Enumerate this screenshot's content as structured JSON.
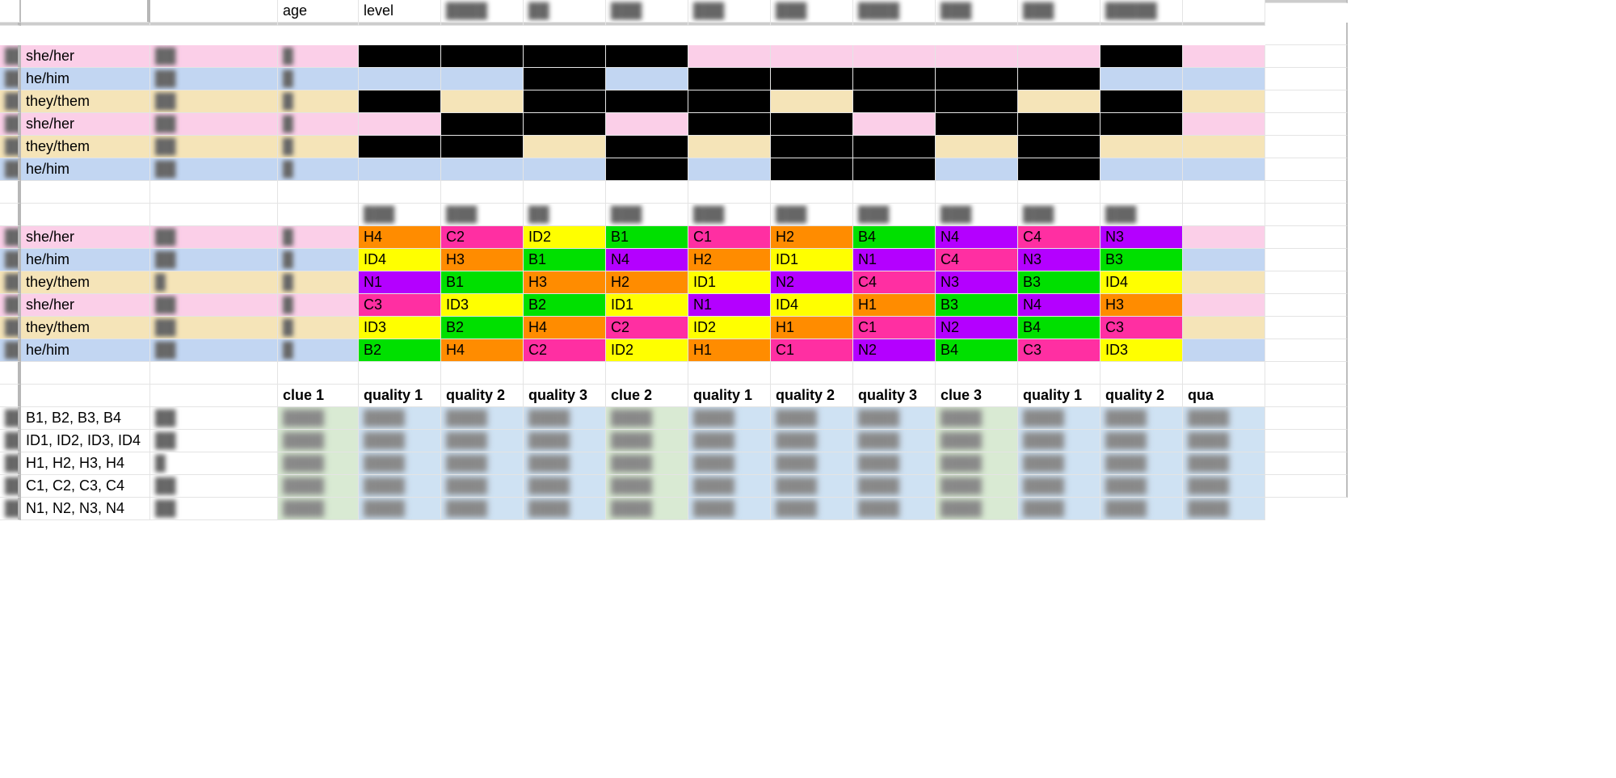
{
  "headers": {
    "age": "age",
    "level": "level",
    "clue1": "clue 1",
    "clue2": "clue 2",
    "clue3": "clue 3",
    "q1": "quality 1",
    "q2": "quality 2",
    "q3": "quality 3",
    "qtrunc": "qua"
  },
  "blurHeaders": [
    "████",
    "██",
    "███",
    "███",
    "███",
    "████",
    "███",
    "███",
    "█████"
  ],
  "top_rows": [
    {
      "name": "███",
      "pronoun": "she/her",
      "age": "██",
      "level": "█",
      "bg": "pink",
      "cells": [
        "k",
        "k",
        "k",
        "k",
        "p",
        "p",
        "p",
        "p",
        "p",
        "k"
      ]
    },
    {
      "name": "██",
      "pronoun": "he/him",
      "age": "██",
      "level": "█",
      "bg": "blue",
      "cells": [
        "b",
        "b",
        "k",
        "b",
        "k",
        "k",
        "k",
        "k",
        "k",
        "b"
      ]
    },
    {
      "name": "████",
      "pronoun": "they/them",
      "age": "██",
      "level": "█",
      "bg": "tan",
      "cells": [
        "k",
        "t",
        "k",
        "k",
        "k",
        "t",
        "k",
        "k",
        "t",
        "k"
      ]
    },
    {
      "name": "███",
      "pronoun": "she/her",
      "age": "██",
      "level": "█",
      "bg": "pink",
      "cells": [
        "p",
        "k",
        "k",
        "p",
        "k",
        "k",
        "p",
        "k",
        "k",
        "k"
      ]
    },
    {
      "name": "███",
      "pronoun": "they/them",
      "age": "██",
      "level": "█",
      "bg": "tan",
      "cells": [
        "k",
        "k",
        "t",
        "k",
        "t",
        "k",
        "k",
        "t",
        "k",
        "t"
      ]
    },
    {
      "name": "████",
      "pronoun": "he/him",
      "age": "██",
      "level": "█",
      "bg": "blue",
      "cells": [
        "b",
        "b",
        "b",
        "k",
        "b",
        "k",
        "k",
        "b",
        "k",
        "b"
      ]
    }
  ],
  "mid_blurHeaders": [
    "███",
    "███",
    "██",
    "███",
    "███",
    "███",
    "███",
    "███",
    "███",
    "███"
  ],
  "code_rows": [
    {
      "name": "███",
      "pronoun": "she/her",
      "age": "██",
      "level": "█",
      "bg": "pink",
      "codes": [
        "H4",
        "C2",
        "ID2",
        "B1",
        "C1",
        "H2",
        "B4",
        "N4",
        "C4",
        "N3"
      ]
    },
    {
      "name": "██",
      "pronoun": "he/him",
      "age": "██",
      "level": "█",
      "bg": "blue",
      "codes": [
        "ID4",
        "H3",
        "B1",
        "N4",
        "H2",
        "ID1",
        "N1",
        "C4",
        "N3",
        "B3"
      ]
    },
    {
      "name": "████",
      "pronoun": "they/them",
      "age": "█",
      "level": "█",
      "bg": "tan",
      "codes": [
        "N1",
        "B1",
        "H3",
        "H2",
        "ID1",
        "N2",
        "C4",
        "N3",
        "B3",
        "ID4"
      ]
    },
    {
      "name": "███",
      "pronoun": "she/her",
      "age": "██",
      "level": "█",
      "bg": "pink",
      "codes": [
        "C3",
        "ID3",
        "B2",
        "ID1",
        "N1",
        "ID4",
        "H1",
        "B3",
        "N4",
        "H3"
      ]
    },
    {
      "name": "███",
      "pronoun": "they/them",
      "age": "██",
      "level": "█",
      "bg": "tan",
      "codes": [
        "ID3",
        "B2",
        "H4",
        "C2",
        "ID2",
        "H1",
        "C1",
        "N2",
        "B4",
        "C3"
      ]
    },
    {
      "name": "████",
      "pronoun": "he/him",
      "age": "██",
      "level": "█",
      "bg": "blue",
      "codes": [
        "B2",
        "H4",
        "C2",
        "ID2",
        "H1",
        "C1",
        "N2",
        "B4",
        "C3",
        "ID3"
      ]
    }
  ],
  "code_colors": {
    "H": "orange",
    "C": "dkpink",
    "ID": "yellow",
    "B": "green",
    "N": "purple"
  },
  "bottom_headers": {
    "cols": [
      "clue 1",
      "quality 1",
      "quality 2",
      "quality 3",
      "clue 2",
      "quality 1",
      "quality 2",
      "quality 3",
      "clue 3",
      "quality 1",
      "quality 2",
      "qua"
    ]
  },
  "bottom_rows": [
    {
      "name": "████",
      "codes": "B1, B2, B3, B4",
      "lvl": "██"
    },
    {
      "name": "█████",
      "codes": "ID1, ID2, ID3, ID4",
      "lvl": "██"
    },
    {
      "name": "██████ r",
      "codes": "H1, H2, H3, H4",
      "lvl": "█"
    },
    {
      "name": "████",
      "codes": "C1, C2, C3, C4",
      "lvl": "██"
    },
    {
      "name": "█████",
      "codes": "N1, N2, N3, N4",
      "lvl": "██"
    }
  ]
}
